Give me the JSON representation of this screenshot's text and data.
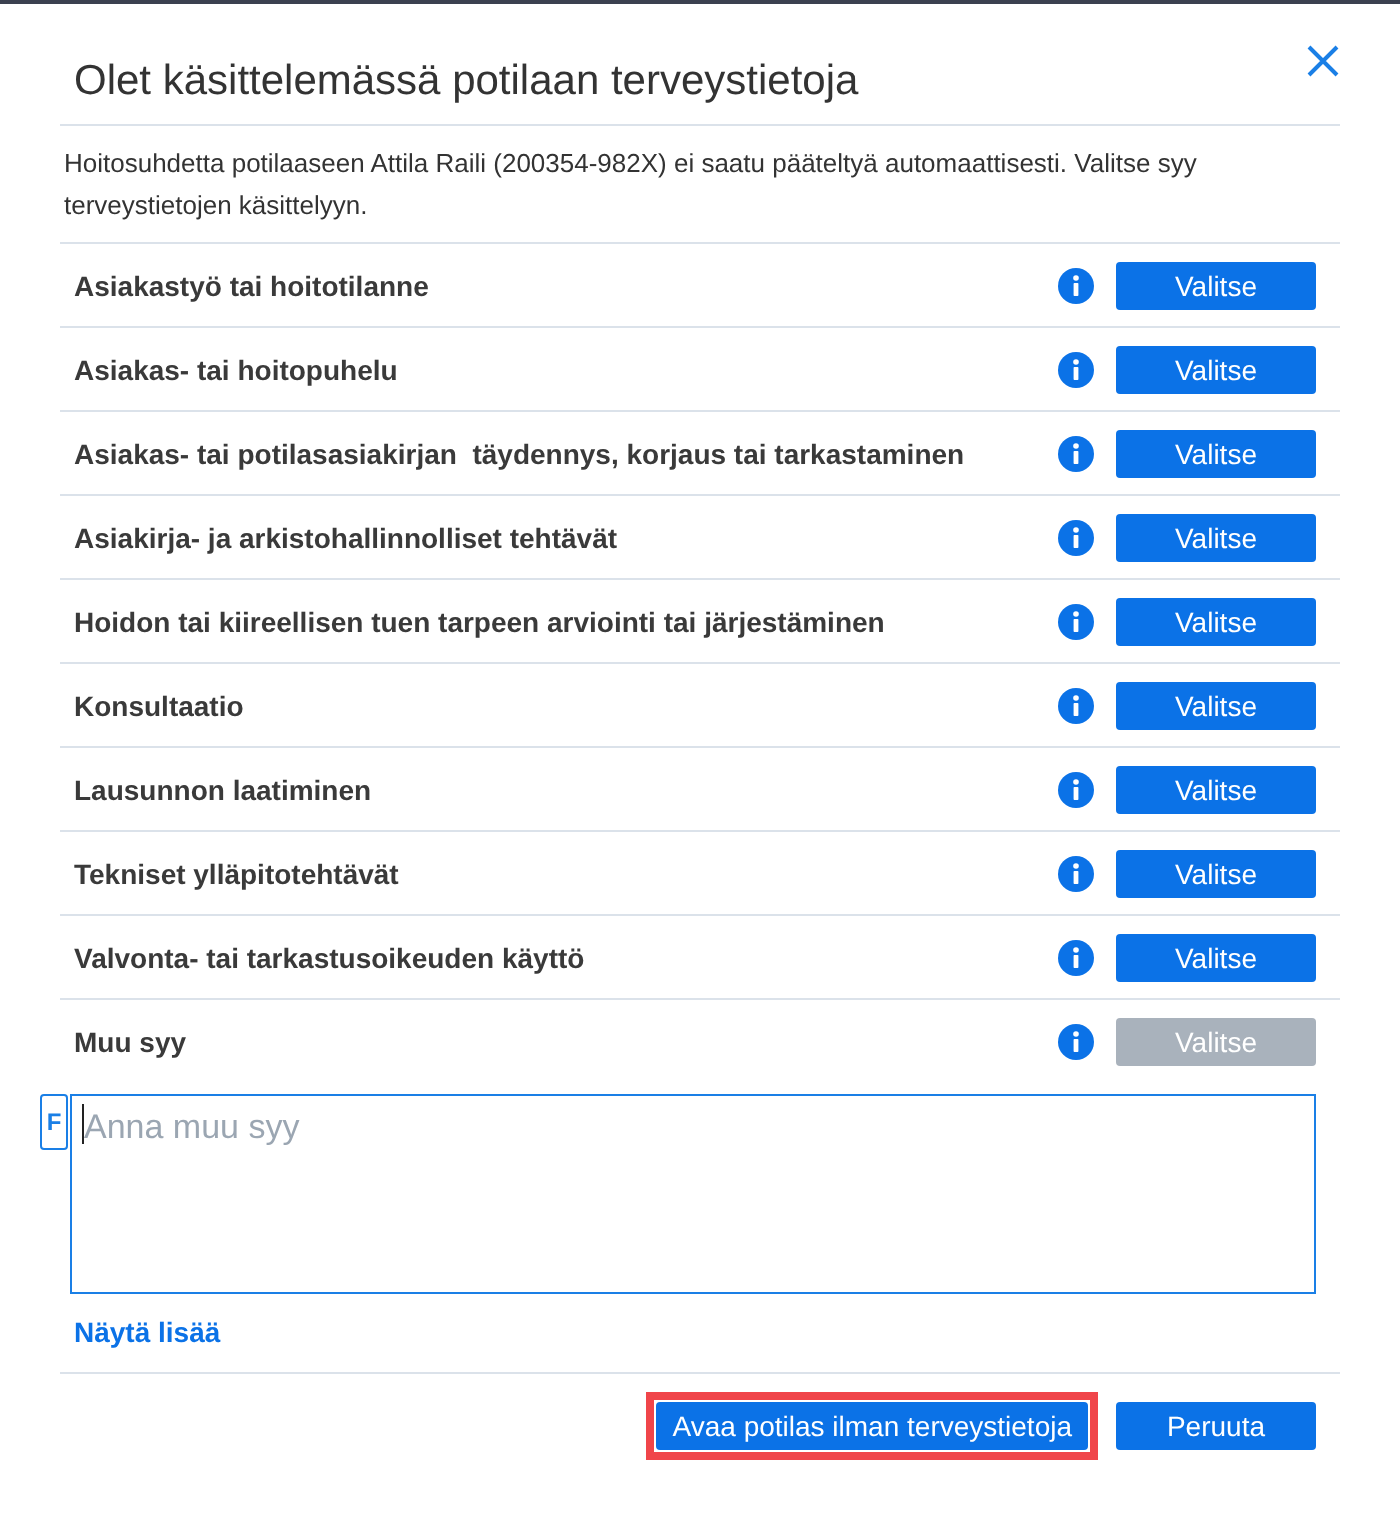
{
  "dialog": {
    "title": "Olet käsittelemässä potilaan terveystietoja",
    "description": "Hoitosuhdetta potilaaseen Attila Raili (200354-982X) ei saatu pääteltyä automaattisesti. Valitse syy terveystietojen käsittelyyn."
  },
  "reasons": [
    {
      "label": "Asiakastyö tai hoitotilanne",
      "button": "Valitse",
      "disabled": false
    },
    {
      "label": "Asiakas- tai hoitopuhelu",
      "button": "Valitse",
      "disabled": false
    },
    {
      "label": "Asiakas- tai potilasasiakirjan  täydennys, korjaus tai tarkastaminen",
      "button": "Valitse",
      "disabled": false
    },
    {
      "label": "Asiakirja- ja arkistohallinnolliset tehtävät",
      "button": "Valitse",
      "disabled": false
    },
    {
      "label": "Hoidon tai kiireellisen tuen tarpeen arviointi tai järjestäminen",
      "button": "Valitse",
      "disabled": false
    },
    {
      "label": "Konsultaatio",
      "button": "Valitse",
      "disabled": false
    },
    {
      "label": "Lausunnon laatiminen",
      "button": "Valitse",
      "disabled": false
    },
    {
      "label": "Tekniset ylläpitotehtävät",
      "button": "Valitse",
      "disabled": false
    },
    {
      "label": "Valvonta- tai tarkastusoikeuden käyttö",
      "button": "Valitse",
      "disabled": false
    },
    {
      "label": "Muu syy",
      "button": "Valitse",
      "disabled": true
    }
  ],
  "other_reason_field": {
    "placeholder": "Anna muu syy",
    "badge": "F",
    "focused": true
  },
  "show_more_link": "Näytä lisää",
  "footer": {
    "buttons": [
      {
        "label": "Avaa potilas ilman terveystietoja",
        "highlighted": true
      },
      {
        "label": "Peruuta",
        "highlighted": false
      }
    ]
  }
}
